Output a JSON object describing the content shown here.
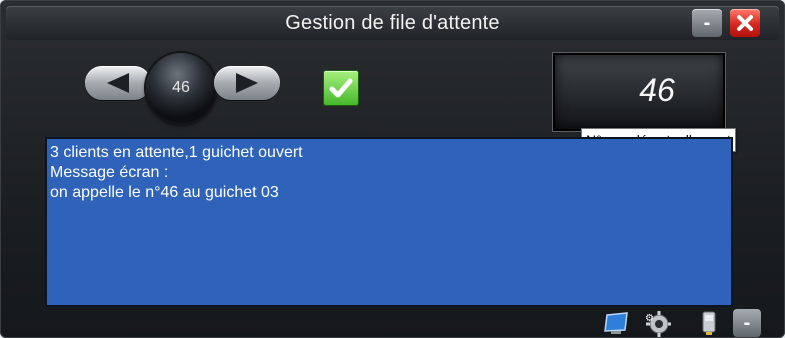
{
  "window": {
    "title": "Gestion de file d'attente",
    "minimize_label": "-",
    "close_icon": "close-icon"
  },
  "navigator": {
    "prev_icon": "arrow-left-icon",
    "current_number": "46",
    "next_icon": "arrow-right-icon",
    "confirm_icon": "check-icon"
  },
  "display": {
    "current_called": "46"
  },
  "tooltip": {
    "text": "N° appelé actuellement"
  },
  "message_box": {
    "lines": [
      "3 clients en attente,1 guichet ouvert",
      "Message écran :",
      "on appelle le n°46 au guichet 03"
    ]
  },
  "toolbar": {
    "icons": [
      "screen-icon",
      "settings-icon",
      "device-icon"
    ],
    "minimize_label": "-"
  },
  "colors": {
    "message_background": "#2f63b9",
    "confirm_green": "#46b82a",
    "close_red": "#d5271d"
  }
}
